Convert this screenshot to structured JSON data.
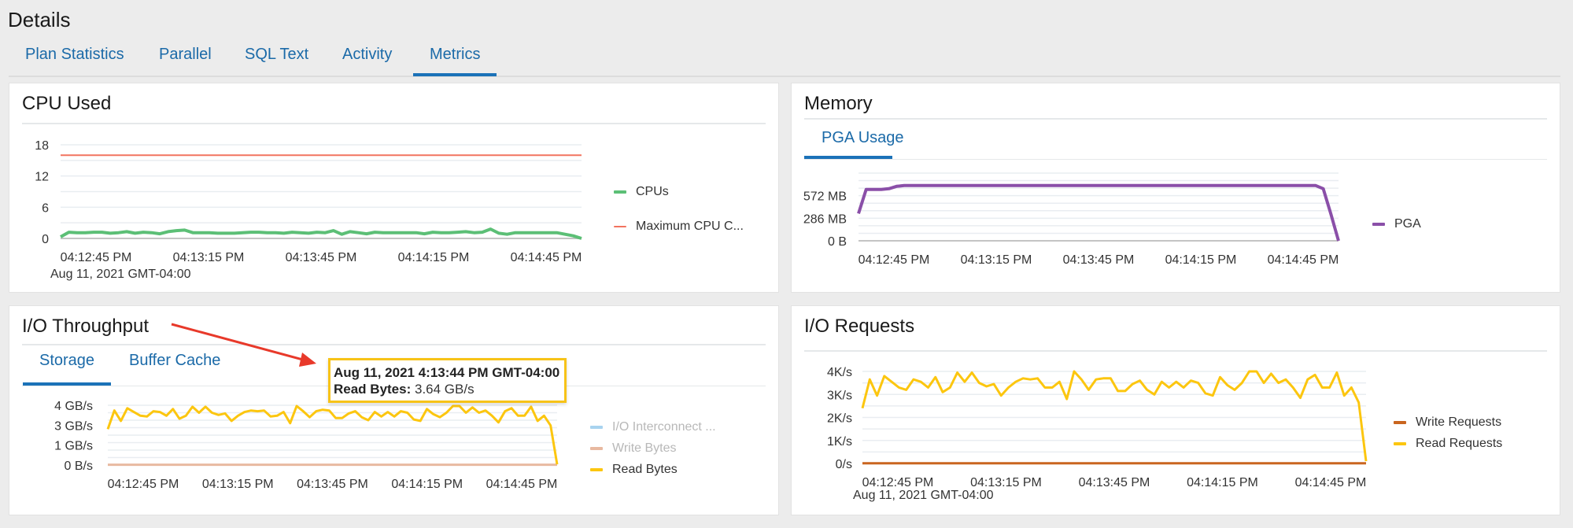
{
  "page": {
    "title": "Details",
    "tabs": [
      {
        "label": "Plan Statistics",
        "active": false
      },
      {
        "label": "Parallel",
        "active": false
      },
      {
        "label": "SQL Text",
        "active": false
      },
      {
        "label": "Activity",
        "active": false
      },
      {
        "label": "Metrics",
        "active": true
      }
    ]
  },
  "colors": {
    "accent": "#1b72b8",
    "cpus": "#5cbf76",
    "max_cpu": "#f2735f",
    "pga": "#8a4fa8",
    "read": "#fcc60f",
    "write_bytes": "#e8b9a0",
    "io_interconnect": "#a8d3ef",
    "write_requests": "#c9651f",
    "tooltip_border": "#f7c318",
    "annotation_arrow": "#e8392a"
  },
  "panels": {
    "cpu": {
      "title": "CPU Used",
      "date_label": "Aug 11, 2021 GMT-04:00",
      "legend": [
        {
          "label": "CPUs",
          "color_key": "cpus"
        },
        {
          "label": "Maximum CPU C...",
          "color_key": "max_cpu"
        }
      ]
    },
    "memory": {
      "title": "Memory",
      "subtabs": [
        {
          "label": "PGA Usage",
          "active": true
        }
      ],
      "legend": [
        {
          "label": "PGA",
          "color_key": "pga"
        }
      ]
    },
    "io_throughput": {
      "title": "I/O Throughput",
      "subtabs": [
        {
          "label": "Storage",
          "active": true
        },
        {
          "label": "Buffer Cache",
          "active": false
        }
      ],
      "legend": [
        {
          "label": "I/O Interconnect ...",
          "color_key": "io_interconnect",
          "dim": true
        },
        {
          "label": "Write Bytes",
          "color_key": "write_bytes",
          "dim": true
        },
        {
          "label": "Read Bytes",
          "color_key": "read",
          "dim": false
        }
      ],
      "tooltip": {
        "timestamp": "Aug 11, 2021 4:13:44 PM GMT-04:00",
        "series_label": "Read Bytes:",
        "value": "3.64 GB/s"
      }
    },
    "io_requests": {
      "title": "I/O Requests",
      "date_label": "Aug 11, 2021 GMT-04:00",
      "legend": [
        {
          "label": "Write Requests",
          "color_key": "write_requests"
        },
        {
          "label": "Read Requests",
          "color_key": "read"
        }
      ]
    }
  },
  "chart_data": [
    {
      "id": "cpu",
      "type": "line",
      "title": "CPU Used",
      "xlabel": "Aug 11, 2021 GMT-04:00",
      "ylabel": "",
      "ylim": [
        0,
        18
      ],
      "yticks": [
        0,
        6,
        12,
        18
      ],
      "ytick_labels": [
        "0",
        "6",
        "12",
        "18"
      ],
      "xtick_labels": [
        "04:12:45 PM",
        "04:13:15 PM",
        "04:13:45 PM",
        "04:14:15 PM",
        "04:14:45 PM"
      ],
      "legend_position": "right",
      "grid": true,
      "series": [
        {
          "name": "CPUs",
          "color_key": "cpus",
          "values": [
            0.3,
            1.2,
            1.1,
            1.1,
            1.2,
            1.2,
            1.0,
            1.1,
            1.3,
            1.0,
            1.2,
            1.1,
            0.9,
            1.3,
            1.5,
            1.6,
            1.1,
            1.1,
            1.1,
            1.0,
            1.0,
            1.0,
            1.1,
            1.2,
            1.2,
            1.1,
            1.1,
            1.0,
            1.2,
            1.1,
            1.0,
            1.2,
            1.1,
            1.5,
            0.8,
            1.3,
            1.1,
            0.9,
            1.2,
            1.1,
            1.1,
            1.1,
            1.1,
            1.1,
            0.9,
            1.2,
            1.1,
            1.1,
            1.2,
            1.3,
            1.1,
            1.2,
            1.8,
            1.0,
            0.8,
            1.1,
            1.1,
            1.1,
            1.1,
            1.1,
            1.1,
            0.8,
            0.5,
            0.0
          ]
        },
        {
          "name": "Maximum CPU C...",
          "color_key": "max_cpu",
          "values": [
            16,
            16
          ]
        }
      ]
    },
    {
      "id": "memory",
      "type": "line",
      "title": "PGA Usage",
      "ylim": [
        0,
        858
      ],
      "yticks": [
        0,
        286,
        572
      ],
      "ytick_labels": [
        "0 B",
        "286 MB",
        "572 MB"
      ],
      "xtick_labels": [
        "04:12:45 PM",
        "04:13:15 PM",
        "04:13:45 PM",
        "04:14:15 PM",
        "04:14:45 PM"
      ],
      "legend_position": "right",
      "grid": true,
      "series": [
        {
          "name": "PGA",
          "color_key": "pga",
          "unit": "MB",
          "values": [
            345,
            650,
            650,
            650,
            660,
            690,
            700,
            700,
            700,
            700,
            700,
            700,
            700,
            700,
            700,
            700,
            700,
            700,
            700,
            700,
            700,
            700,
            700,
            700,
            700,
            700,
            700,
            700,
            700,
            700,
            700,
            700,
            700,
            700,
            700,
            700,
            700,
            700,
            700,
            700,
            700,
            700,
            700,
            700,
            700,
            700,
            700,
            700,
            700,
            700,
            700,
            700,
            700,
            700,
            700,
            700,
            700,
            700,
            700,
            700,
            700,
            660,
            340,
            0
          ]
        }
      ]
    },
    {
      "id": "io_throughput",
      "type": "line",
      "title": "I/O Throughput - Storage",
      "ylim": [
        0,
        4
      ],
      "yticks": [
        0,
        1.33,
        2.67,
        4
      ],
      "ytick_labels": [
        "0 B/s",
        "1 GB/s",
        "3 GB/s",
        "4 GB/s"
      ],
      "xtick_labels": [
        "04:12:45 PM",
        "04:13:15 PM",
        "04:13:45 PM",
        "04:14:15 PM",
        "04:14:45 PM"
      ],
      "legend_position": "right",
      "grid": true,
      "series": [
        {
          "name": "I/O Interconnect ...",
          "color_key": "io_interconnect",
          "values": []
        },
        {
          "name": "Write Bytes",
          "color_key": "write_bytes",
          "unit": "GB/s",
          "values": [
            0.02,
            0.02,
            0.02,
            0.02,
            0.02,
            0.02,
            0.02,
            0.02,
            0.02,
            0.02
          ]
        },
        {
          "name": "Read Bytes",
          "color_key": "read",
          "unit": "GB/s",
          "values": [
            2.4,
            3.65,
            2.95,
            3.8,
            3.55,
            3.3,
            3.25,
            3.6,
            3.55,
            3.3,
            3.75,
            3.1,
            3.3,
            3.9,
            3.5,
            3.9,
            3.5,
            3.35,
            3.45,
            2.95,
            3.3,
            3.55,
            3.65,
            3.6,
            3.65,
            3.25,
            3.3,
            3.55,
            2.8,
            3.95,
            3.6,
            3.2,
            3.6,
            3.7,
            3.65,
            3.15,
            3.15,
            3.45,
            3.6,
            3.2,
            3.0,
            3.55,
            3.25,
            3.55,
            3.25,
            3.6,
            3.5,
            3.05,
            2.95,
            3.75,
            3.4,
            3.2,
            3.5,
            3.95,
            3.95,
            3.5,
            3.85,
            3.5,
            3.65,
            3.3,
            2.85,
            3.6,
            3.8,
            3.3,
            3.3,
            3.9,
            2.95,
            3.3,
            2.65,
            0.05
          ]
        }
      ],
      "tooltip": {
        "x": "Aug 11, 2021 4:13:44 PM GMT-04:00",
        "series": "Read Bytes",
        "value": 3.64,
        "unit": "GB/s"
      }
    },
    {
      "id": "io_requests",
      "type": "line",
      "title": "I/O Requests",
      "xlabel": "Aug 11, 2021 GMT-04:00",
      "ylim": [
        0,
        4
      ],
      "yticks": [
        0,
        1,
        2,
        3,
        4
      ],
      "ytick_labels": [
        "0/s",
        "1K/s",
        "2K/s",
        "3K/s",
        "4K/s"
      ],
      "xtick_labels": [
        "04:12:45 PM",
        "04:13:15 PM",
        "04:13:45 PM",
        "04:14:15 PM",
        "04:14:45 PM"
      ],
      "legend_position": "right",
      "grid": true,
      "series": [
        {
          "name": "Write Requests",
          "color_key": "write_requests",
          "unit": "K/s",
          "values": [
            0.01,
            0.01,
            0.01,
            0.01,
            0.01,
            0.01,
            0.01,
            0.01,
            0.01,
            0.01
          ]
        },
        {
          "name": "Read Requests",
          "color_key": "read",
          "unit": "K/s",
          "values": [
            2.4,
            3.65,
            2.95,
            3.8,
            3.55,
            3.3,
            3.2,
            3.65,
            3.55,
            3.3,
            3.75,
            3.1,
            3.3,
            3.95,
            3.55,
            3.95,
            3.5,
            3.35,
            3.45,
            2.95,
            3.3,
            3.55,
            3.7,
            3.65,
            3.7,
            3.3,
            3.3,
            3.55,
            2.8,
            4.0,
            3.65,
            3.2,
            3.65,
            3.7,
            3.7,
            3.15,
            3.15,
            3.45,
            3.6,
            3.2,
            3.0,
            3.55,
            3.3,
            3.55,
            3.3,
            3.6,
            3.5,
            3.05,
            2.95,
            3.75,
            3.4,
            3.2,
            3.5,
            4.0,
            4.0,
            3.5,
            3.9,
            3.5,
            3.65,
            3.3,
            2.85,
            3.65,
            3.85,
            3.3,
            3.3,
            3.95,
            2.95,
            3.3,
            2.65,
            0.1
          ]
        }
      ]
    }
  ]
}
